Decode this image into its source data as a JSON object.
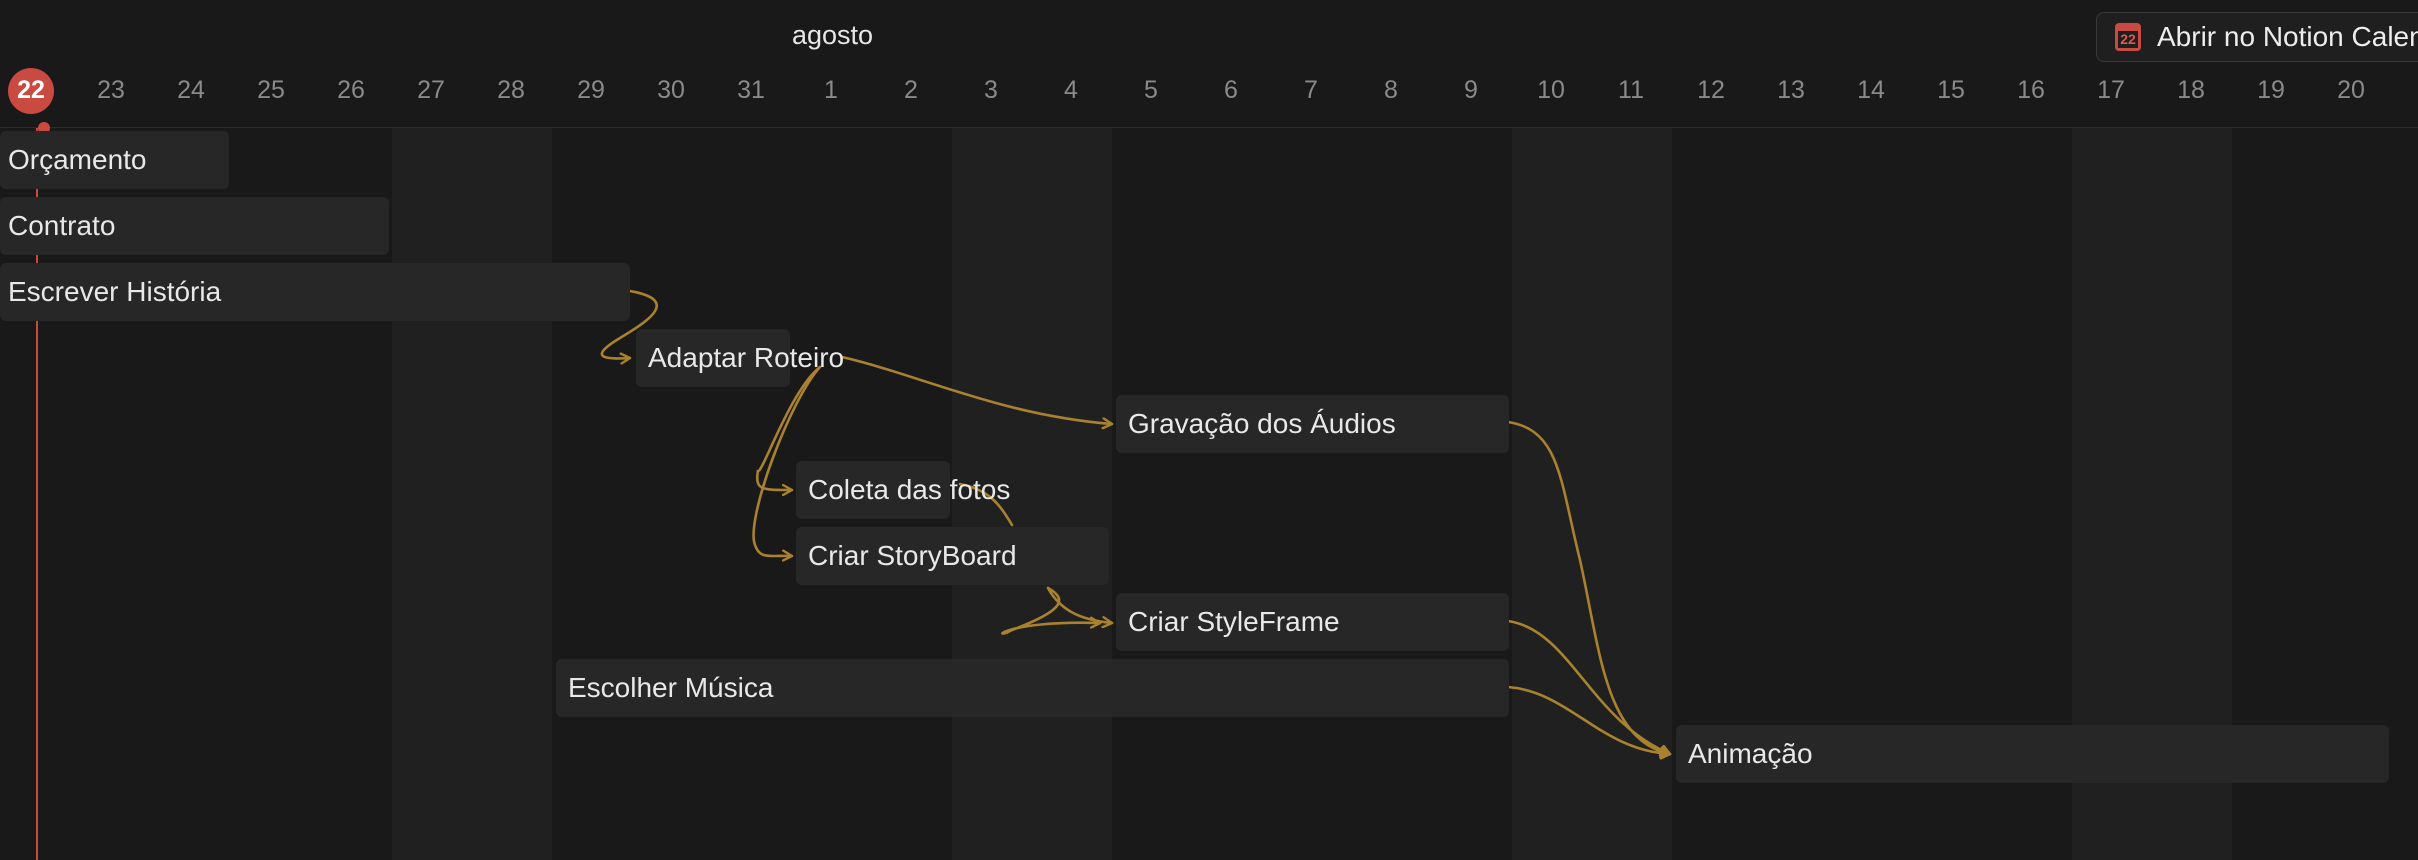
{
  "header": {
    "month": "agosto",
    "open_button": {
      "label": "Abrir no Notion Calendar",
      "icon": "calendar-icon",
      "icon_number": "22"
    },
    "days": [
      "22",
      "23",
      "24",
      "25",
      "26",
      "27",
      "28",
      "29",
      "30",
      "31",
      "1",
      "2",
      "3",
      "4",
      "5",
      "6",
      "7",
      "8",
      "9",
      "10",
      "11",
      "12",
      "13",
      "14",
      "15",
      "16",
      "17",
      "18",
      "19",
      "20"
    ],
    "today": "22"
  },
  "tasks": [
    {
      "name": "Orçamento"
    },
    {
      "name": "Contrato"
    },
    {
      "name": "Escrever História"
    },
    {
      "name": "Adaptar Roteiro"
    },
    {
      "name": "Gravação dos Áudios"
    },
    {
      "name": "Coleta das fotos"
    },
    {
      "name": "Criar StoryBoard"
    },
    {
      "name": "Criar StyleFrame"
    },
    {
      "name": "Escolher Música"
    },
    {
      "name": "Animação"
    }
  ],
  "colors": {
    "background": "#191919",
    "weekend": "#202020",
    "task_bar": "#272727",
    "dependency": "#a9822f",
    "today": "#c94a41"
  }
}
